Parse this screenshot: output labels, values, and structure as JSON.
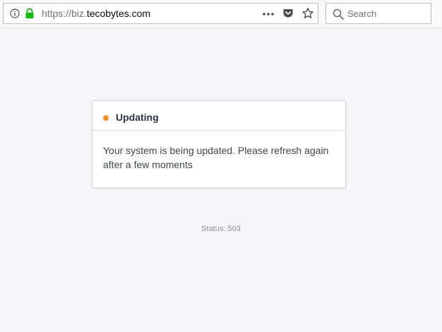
{
  "browser": {
    "url_prefix": "https://biz.",
    "url_domain": "tecobytes.com",
    "search_placeholder": "Search",
    "icons": {
      "info": "info-icon",
      "lock": "lock-icon",
      "more": "more-icon",
      "pocket": "pocket-icon",
      "bookmark": "star-icon",
      "search": "search-icon"
    },
    "colors": {
      "lock": "#12bc00"
    }
  },
  "card": {
    "title": "Updating",
    "message": "Your system is being updated. Please refresh again after a few moments",
    "dot_color": "#f7931e"
  },
  "status": "Status: 503"
}
